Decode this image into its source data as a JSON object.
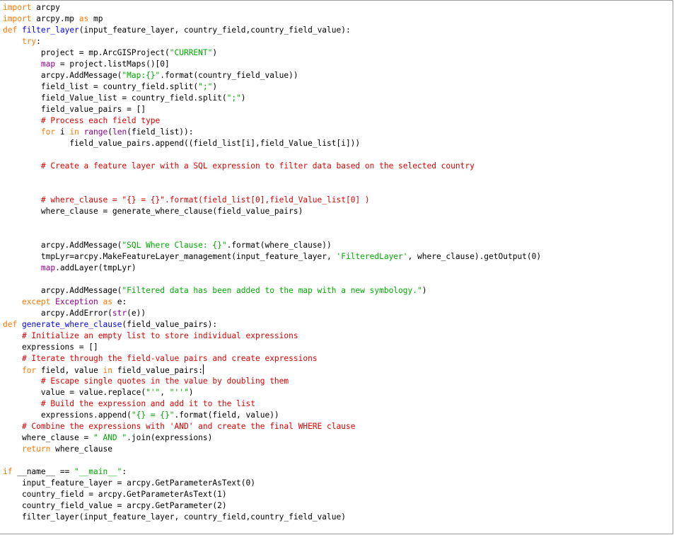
{
  "editor": {
    "lines": [
      [
        {
          "t": "kw",
          "v": "import"
        },
        {
          "t": "",
          "v": " arcpy"
        }
      ],
      [
        {
          "t": "kw",
          "v": "import"
        },
        {
          "t": "",
          "v": " arcpy.mp "
        },
        {
          "t": "kw",
          "v": "as"
        },
        {
          "t": "",
          "v": " mp"
        }
      ],
      [
        {
          "t": "kw",
          "v": "def"
        },
        {
          "t": "",
          "v": " "
        },
        {
          "t": "fn",
          "v": "filter_layer"
        },
        {
          "t": "",
          "v": "(input_feature_layer, country_field,country_field_value):"
        }
      ],
      [
        {
          "t": "",
          "v": "    "
        },
        {
          "t": "kw",
          "v": "try"
        },
        {
          "t": "",
          "v": ":"
        }
      ],
      [
        {
          "t": "",
          "v": "        project = mp.ArcGISProject("
        },
        {
          "t": "str",
          "v": "\"CURRENT\""
        },
        {
          "t": "",
          "v": ")"
        }
      ],
      [
        {
          "t": "",
          "v": "        "
        },
        {
          "t": "bi",
          "v": "map"
        },
        {
          "t": "",
          "v": " = project.listMaps()[0]"
        }
      ],
      [
        {
          "t": "",
          "v": "        arcpy.AddMessage("
        },
        {
          "t": "str",
          "v": "\"Map:{}\""
        },
        {
          "t": "",
          "v": ".format(country_field_value))"
        }
      ],
      [
        {
          "t": "",
          "v": "        field_list = country_field.split("
        },
        {
          "t": "str",
          "v": "\";\""
        },
        {
          "t": "",
          "v": ")"
        }
      ],
      [
        {
          "t": "",
          "v": "        field_Value_list = country_field.split("
        },
        {
          "t": "str",
          "v": "\";\""
        },
        {
          "t": "",
          "v": ")"
        }
      ],
      [
        {
          "t": "",
          "v": "        field_value_pairs = []"
        }
      ],
      [
        {
          "t": "",
          "v": "        "
        },
        {
          "t": "com",
          "v": "# Process each field type"
        }
      ],
      [
        {
          "t": "",
          "v": "        "
        },
        {
          "t": "kw",
          "v": "for"
        },
        {
          "t": "",
          "v": " i "
        },
        {
          "t": "kw",
          "v": "in"
        },
        {
          "t": "",
          "v": " "
        },
        {
          "t": "bi",
          "v": "range"
        },
        {
          "t": "",
          "v": "("
        },
        {
          "t": "bi",
          "v": "len"
        },
        {
          "t": "",
          "v": "(field_list)):"
        }
      ],
      [
        {
          "t": "",
          "v": "              field_value_pairs.append((field_list[i],field_Value_list[i]))"
        }
      ],
      [],
      [
        {
          "t": "",
          "v": "        "
        },
        {
          "t": "com",
          "v": "# Create a feature layer with a SQL expression to filter data based on the selected country"
        }
      ],
      [],
      [],
      [
        {
          "t": "",
          "v": "        "
        },
        {
          "t": "com",
          "v": "# where_clause = \"{} = {}\".format(field_list[0],field_Value_list[0] )"
        }
      ],
      [
        {
          "t": "",
          "v": "        where_clause = generate_where_clause(field_value_pairs)"
        }
      ],
      [],
      [],
      [
        {
          "t": "",
          "v": "        arcpy.AddMessage("
        },
        {
          "t": "str",
          "v": "\"SQL Where Clause: {}\""
        },
        {
          "t": "",
          "v": ".format(where_clause))"
        }
      ],
      [
        {
          "t": "",
          "v": "        tmpLyr=arcpy.MakeFeatureLayer_management(input_feature_layer, "
        },
        {
          "t": "str",
          "v": "'FilteredLayer'"
        },
        {
          "t": "",
          "v": ", where_clause).getOutput(0)"
        }
      ],
      [
        {
          "t": "",
          "v": "        "
        },
        {
          "t": "bi",
          "v": "map"
        },
        {
          "t": "",
          "v": ".addLayer(tmpLyr)"
        }
      ],
      [],
      [
        {
          "t": "",
          "v": "        arcpy.AddMessage("
        },
        {
          "t": "str",
          "v": "\"Filtered data has been added to the map with a new symbology.\""
        },
        {
          "t": "",
          "v": ")"
        }
      ],
      [
        {
          "t": "",
          "v": "    "
        },
        {
          "t": "kw",
          "v": "except"
        },
        {
          "t": "",
          "v": " "
        },
        {
          "t": "bi",
          "v": "Exception"
        },
        {
          "t": "",
          "v": " "
        },
        {
          "t": "kw",
          "v": "as"
        },
        {
          "t": "",
          "v": " e:"
        }
      ],
      [
        {
          "t": "",
          "v": "        arcpy.AddError("
        },
        {
          "t": "bi",
          "v": "str"
        },
        {
          "t": "",
          "v": "(e))"
        }
      ],
      [
        {
          "t": "kw",
          "v": "def"
        },
        {
          "t": "",
          "v": " "
        },
        {
          "t": "fn",
          "v": "generate_where_clause"
        },
        {
          "t": "",
          "v": "(field_value_pairs):"
        }
      ],
      [
        {
          "t": "",
          "v": "    "
        },
        {
          "t": "com",
          "v": "# Initialize an empty list to store individual expressions"
        }
      ],
      [
        {
          "t": "",
          "v": "    expressions = []"
        }
      ],
      [
        {
          "t": "",
          "v": "    "
        },
        {
          "t": "com",
          "v": "# Iterate through the field-value pairs and create expressions"
        }
      ],
      [
        {
          "t": "",
          "v": "    "
        },
        {
          "t": "kw",
          "v": "for"
        },
        {
          "t": "",
          "v": " field, value "
        },
        {
          "t": "kw",
          "v": "in"
        },
        {
          "t": "",
          "v": " field_value_pairs:"
        },
        {
          "t": "caret",
          "v": ""
        }
      ],
      [
        {
          "t": "",
          "v": "        "
        },
        {
          "t": "com",
          "v": "# Escape single quotes in the value by doubling them"
        }
      ],
      [
        {
          "t": "",
          "v": "        value = value.replace("
        },
        {
          "t": "str",
          "v": "\"'\""
        },
        {
          "t": "",
          "v": ", "
        },
        {
          "t": "str",
          "v": "\"''\""
        },
        {
          "t": "",
          "v": ")"
        }
      ],
      [
        {
          "t": "",
          "v": "        "
        },
        {
          "t": "com",
          "v": "# Build the expression and add it to the list"
        }
      ],
      [
        {
          "t": "",
          "v": "        expressions.append("
        },
        {
          "t": "str",
          "v": "\"{} = {}\""
        },
        {
          "t": "",
          "v": ".format(field, value))"
        }
      ],
      [
        {
          "t": "",
          "v": "    "
        },
        {
          "t": "com",
          "v": "# Combine the expressions with 'AND' and create the final WHERE clause"
        }
      ],
      [
        {
          "t": "",
          "v": "    where_clause = "
        },
        {
          "t": "str",
          "v": "\" AND \""
        },
        {
          "t": "",
          "v": ".join(expressions)"
        }
      ],
      [
        {
          "t": "",
          "v": "    "
        },
        {
          "t": "kw",
          "v": "return"
        },
        {
          "t": "",
          "v": " where_clause"
        }
      ],
      [],
      [
        {
          "t": "kw",
          "v": "if"
        },
        {
          "t": "",
          "v": " __name__ == "
        },
        {
          "t": "str",
          "v": "\"__main__\""
        },
        {
          "t": "",
          "v": ":"
        }
      ],
      [
        {
          "t": "",
          "v": "    input_feature_layer = arcpy.GetParameterAsText(0)"
        }
      ],
      [
        {
          "t": "",
          "v": "    country_field = arcpy.GetParameterAsText(1)"
        }
      ],
      [
        {
          "t": "",
          "v": "    country_field_value = arcpy.GetParameter(2)"
        }
      ],
      [
        {
          "t": "",
          "v": "    filter_layer(input_feature_layer, country_field,country_field_value)"
        }
      ]
    ]
  }
}
